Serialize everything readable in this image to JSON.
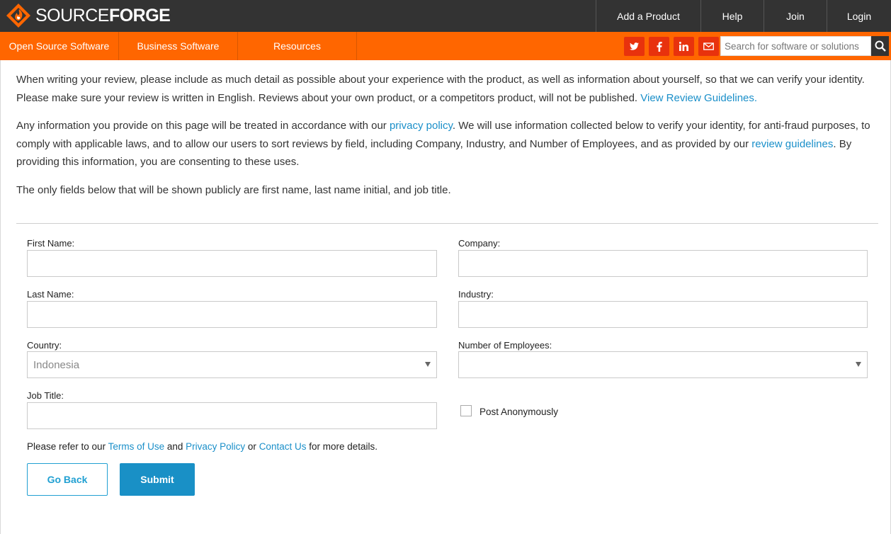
{
  "header": {
    "logo_text_light": "SOURCE",
    "logo_text_bold": "FORGE",
    "nav": [
      "Add a Product",
      "Help",
      "Join",
      "Login"
    ]
  },
  "subnav": {
    "items": [
      "Open Source Software",
      "Business Software",
      "Resources"
    ],
    "social_icons": [
      "twitter-icon",
      "facebook-icon",
      "linkedin-icon",
      "mail-icon"
    ],
    "search_placeholder": "Search for software or solutions"
  },
  "intro": {
    "p1_text": "When writing your review, please include as much detail as possible about your experience with the product, as well as information about yourself, so that we can verify your identity. Please make sure your review is written in English. Reviews about your own product, or a competitors product, will not be published. ",
    "p1_link": "View Review Guidelines.",
    "p2_a": "Any information you provide on this page will be treated in accordance with our ",
    "p2_link1": "privacy policy",
    "p2_b": ". We will use information collected below to verify your identity, for anti-fraud purposes, to comply with applicable laws, and to allow our users to sort reviews by field, including Company, Industry, and Number of Employees, and as provided by our ",
    "p2_link2": "review guidelines",
    "p2_c": ". By providing this information, you are consenting to these uses.",
    "p3_text": "The only fields below that will be shown publicly are first name, last name initial, and job title."
  },
  "form": {
    "first_name_label": "First Name:",
    "last_name_label": "Last Name:",
    "country_label": "Country:",
    "country_value": "Indonesia",
    "job_title_label": "Job Title:",
    "company_label": "Company:",
    "industry_label": "Industry:",
    "employees_label": "Number of Employees:",
    "employees_value": "",
    "anonymous_label": "Post Anonymously",
    "refer_a": "Please refer to our ",
    "terms_link": "Terms of Use",
    "refer_b": " and ",
    "privacy_link": "Privacy Policy",
    "refer_c": " or ",
    "contact_link": "Contact Us",
    "refer_d": " for more details.",
    "back_label": "Go Back",
    "submit_label": "Submit"
  },
  "colors": {
    "topbar": "#333333",
    "orange": "#ff6600",
    "social": "#e8320d",
    "link": "#1a8fc9",
    "submit": "#1990c6"
  }
}
